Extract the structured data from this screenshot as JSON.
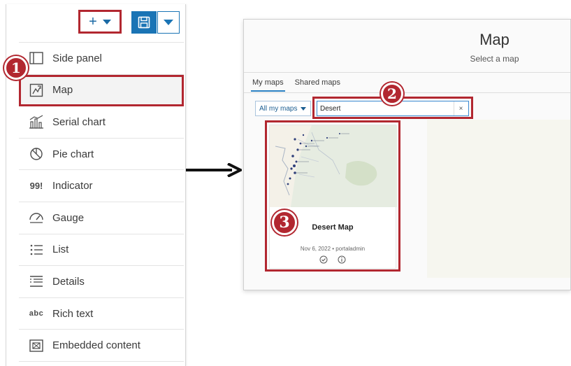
{
  "toolbar": {
    "add_symbol": "+",
    "add_icon": "plus-icon",
    "save_icon": "floppy-disk-icon",
    "accent_color": "#1a74b5"
  },
  "menu": {
    "items": [
      {
        "label": "Side panel",
        "icon": "side-panel-icon"
      },
      {
        "label": "Map",
        "icon": "map-icon"
      },
      {
        "label": "Serial chart",
        "icon": "serial-chart-icon"
      },
      {
        "label": "Pie chart",
        "icon": "pie-chart-icon"
      },
      {
        "label": "Indicator",
        "icon": "indicator-icon",
        "glyph": "99!"
      },
      {
        "label": "Gauge",
        "icon": "gauge-icon"
      },
      {
        "label": "List",
        "icon": "list-icon"
      },
      {
        "label": "Details",
        "icon": "details-icon"
      },
      {
        "label": "Rich text",
        "icon": "rich-text-icon",
        "glyph": "abc"
      },
      {
        "label": "Embedded content",
        "icon": "embedded-content-icon"
      }
    ]
  },
  "annotations": {
    "step1": "1",
    "step2": "2",
    "step3": "3",
    "highlight_color": "#b22730"
  },
  "dialog": {
    "title": "Map",
    "subtitle": "Select a map",
    "tabs": [
      {
        "label": "My maps",
        "active": true
      },
      {
        "label": "Shared maps",
        "active": false
      }
    ],
    "filter": {
      "label": "All my maps"
    },
    "search": {
      "value": "Desert",
      "clear_symbol": "×"
    },
    "card": {
      "title": "Desert Map",
      "date": "Nov 6, 2022",
      "separator": "•",
      "owner": "portaladmin",
      "select_icon": "check-circle-icon",
      "info_icon": "info-icon"
    }
  }
}
